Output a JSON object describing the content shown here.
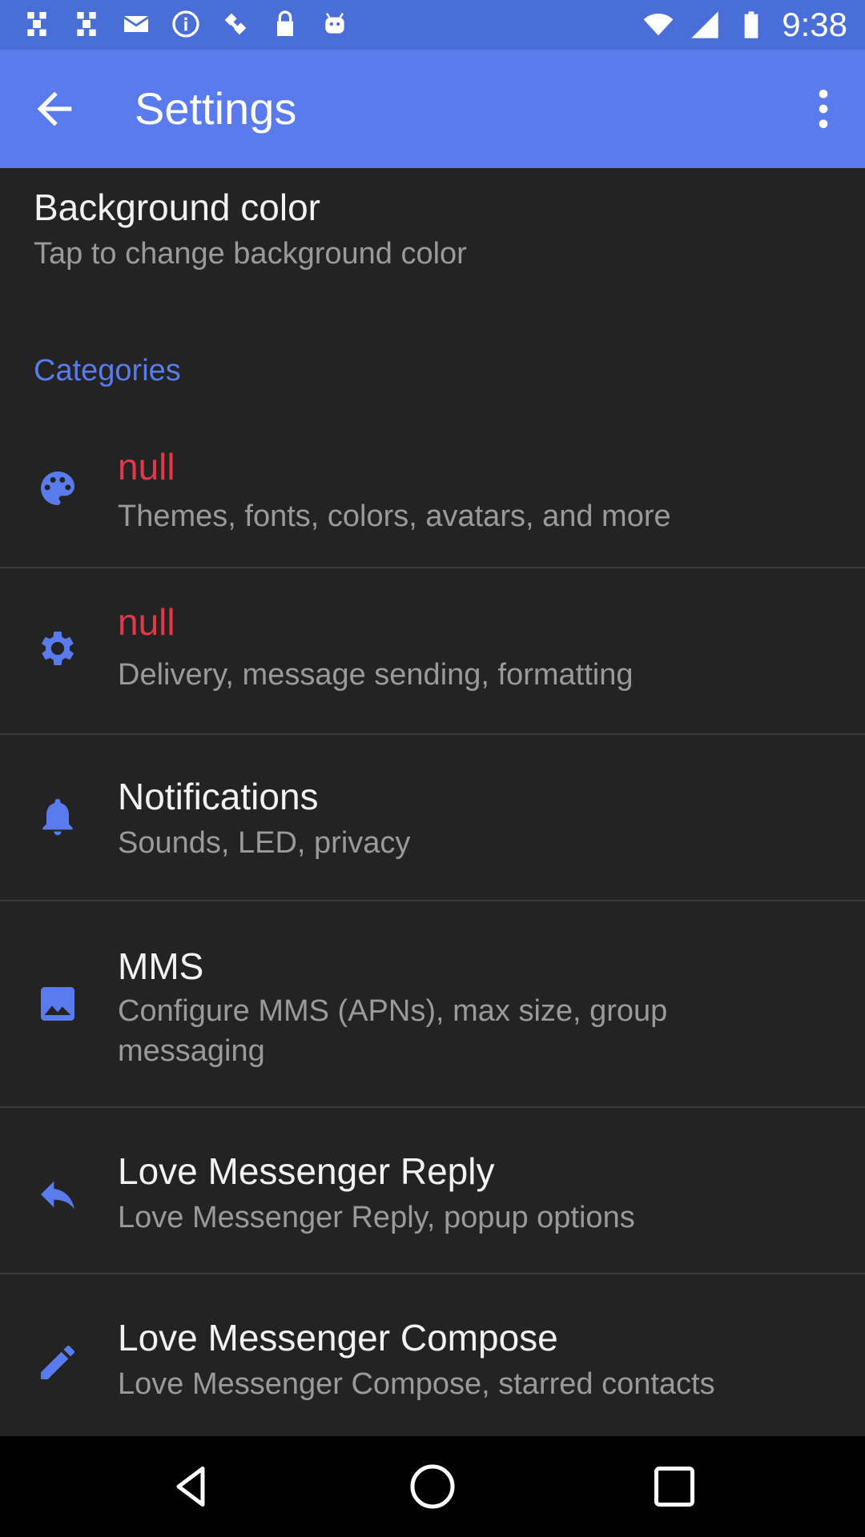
{
  "status_bar": {
    "time": "9:38",
    "left_icons": [
      "slack-icon",
      "slack-icon",
      "mail-icon",
      "info-icon",
      "satellite-icon",
      "lock-icon",
      "android-icon"
    ],
    "right_icons": [
      "wifi-icon",
      "signal-icon",
      "battery-icon"
    ]
  },
  "app_bar": {
    "title": "Settings",
    "back_icon": "arrow-back-icon",
    "menu_icon": "more-vert-icon",
    "color": "#5a7bee"
  },
  "background_color": {
    "title": "Background color",
    "subtitle": "Tap to change background color"
  },
  "categories_label": "Categories",
  "items": [
    {
      "icon": "palette-icon",
      "title": "null",
      "subtitle": "Themes, fonts, colors, avatars, and more"
    },
    {
      "icon": "gear-icon",
      "title": "null",
      "subtitle": "Delivery, message sending, formatting"
    },
    {
      "icon": "bell-icon",
      "title": "Notifications",
      "subtitle": "Sounds, LED, privacy"
    },
    {
      "icon": "image-icon",
      "title": "MMS",
      "subtitle": "Configure MMS (APNs), max size, group messaging"
    },
    {
      "icon": "reply-icon",
      "title": "Love Messenger Reply",
      "subtitle": "Love Messenger Reply, popup options"
    },
    {
      "icon": "pencil-icon",
      "title": "Love Messenger Compose",
      "subtitle": "Love Messenger Compose, starred contacts"
    }
  ],
  "colors": {
    "accent": "#5a7bee",
    "null_text": "#e0394a",
    "background": "#232323"
  },
  "nav_bar": {
    "buttons": [
      "back-nav-icon",
      "home-nav-icon",
      "recents-nav-icon"
    ]
  }
}
